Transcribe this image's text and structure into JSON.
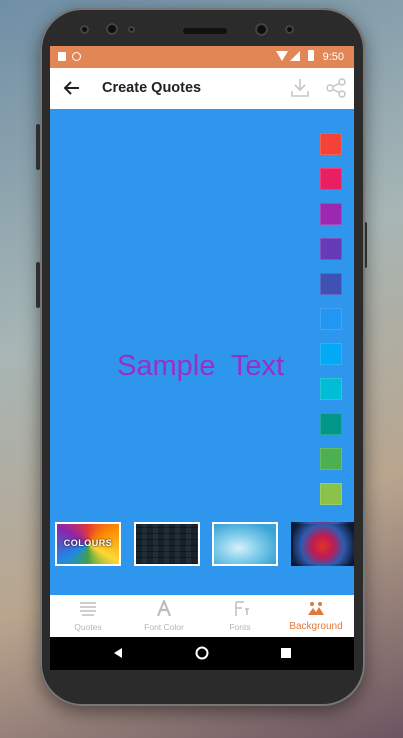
{
  "status_bar": {
    "time": "9:50"
  },
  "toolbar": {
    "title": "Create Quotes",
    "back_icon": "arrow-left-icon",
    "download_icon": "download-icon",
    "share_icon": "share-icon"
  },
  "canvas": {
    "background_color": "#2f96ee",
    "sample_text": "Sample  Text",
    "text_color": "#9a2fc7"
  },
  "color_swatches": [
    "#f44336",
    "#e91e63",
    "#9c27b0",
    "#673ab7",
    "#3f51b5",
    "#2196f3",
    "#03a9f4",
    "#00bcd4",
    "#009688",
    "#4caf50",
    "#8bc34a"
  ],
  "background_thumbnails": [
    {
      "name": "colours",
      "label": "COLOURS"
    },
    {
      "name": "dark-brick"
    },
    {
      "name": "blue-clouds"
    },
    {
      "name": "color-smoke"
    }
  ],
  "bottom_nav": {
    "items": [
      {
        "label": "Quotes",
        "icon": "quotes-icon"
      },
      {
        "label": "Font Color",
        "icon": "font-color-icon"
      },
      {
        "label": "Fonts",
        "icon": "fonts-icon"
      },
      {
        "label": "Background",
        "icon": "background-icon",
        "active": true
      }
    ]
  },
  "colors": {
    "status_bar": "#e38656",
    "accent": "#e07a3c"
  }
}
